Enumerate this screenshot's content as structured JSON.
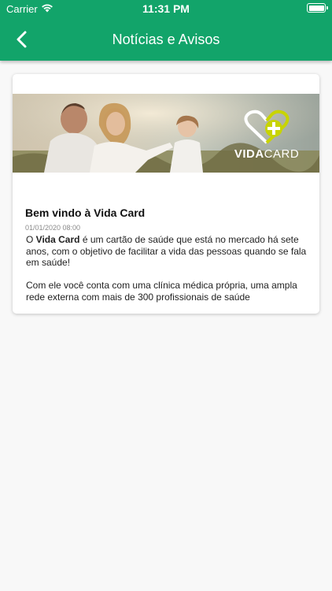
{
  "status_bar": {
    "carrier": "Carrier",
    "time": "11:31 PM"
  },
  "nav": {
    "back_icon": "chevron-left-icon",
    "title": "Notícias e Avisos"
  },
  "news": [
    {
      "image": "family-photo-vidacard-banner",
      "brand": {
        "part1": "VIDA",
        "part2": "CARD"
      },
      "title": "Bem vindo à Vida Card",
      "date": "01/01/2020 08:00",
      "paragraph1_pre": "O ",
      "paragraph1_bold": "Vida Card",
      "paragraph1_post": " é um cartão de saúde que está no mercado há sete anos, com o objetivo de facilitar a vida das pessoas quando se fala em saúde!",
      "paragraph2": "Com ele você conta com uma clínica médica própria, uma ampla rede externa com mais de 300 profissionais de saúde"
    }
  ],
  "colors": {
    "header": "#12a46a",
    "logo_accent": "#c8d400"
  }
}
